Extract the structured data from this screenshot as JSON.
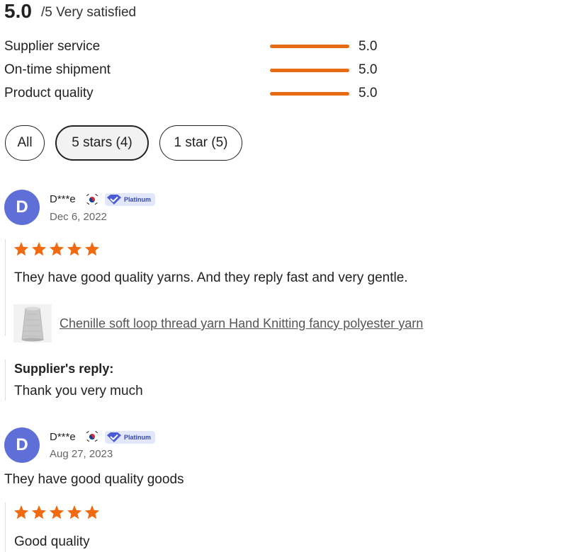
{
  "summary": {
    "score": "5.0",
    "score_suffix": "/5 Very satisfied"
  },
  "metrics": [
    {
      "label": "Supplier service",
      "value": "5.0",
      "level": 1.0
    },
    {
      "label": "On-time shipment",
      "value": "5.0",
      "level": 1.0
    },
    {
      "label": "Product quality",
      "value": "5.0",
      "level": 1.0
    }
  ],
  "filters": [
    {
      "label": "All",
      "selected": false
    },
    {
      "label": "5 stars (4)",
      "selected": true
    },
    {
      "label": "1 star (5)",
      "selected": false
    }
  ],
  "reviews": [
    {
      "avatar_letter": "D",
      "name": "D***e",
      "country_flag": "south-korea-flag-icon",
      "badge": "Platinum",
      "date": "Dec 6, 2022",
      "rating": 5,
      "text": "They have good quality yarns. And they reply fast and very gentle.",
      "product": "Chenille soft loop thread yarn Hand Knitting fancy polyester yarn",
      "reply_title": "Supplier's reply:",
      "reply_text": "Thank you very much"
    },
    {
      "avatar_letter": "D",
      "name": "D***e",
      "country_flag": "south-korea-flag-icon",
      "badge": "Platinum",
      "date": "Aug 27, 2023",
      "comment": "They have good quality goods",
      "rating": 5,
      "text": "Good quality"
    }
  ],
  "colors": {
    "accent": "#e66b12",
    "avatar": "#5e6fd8",
    "badge_bg": "#e3e7fb",
    "badge_text": "#3747b0"
  }
}
